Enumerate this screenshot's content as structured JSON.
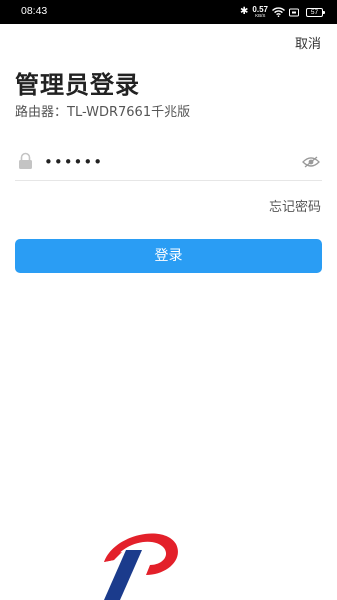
{
  "status_bar": {
    "time": "08:43",
    "network_speed": "0.57",
    "network_unit": "KB/S",
    "battery": "57",
    "icons": [
      "bluetooth-icon",
      "wifi-icon",
      "battery-saver-icon",
      "battery-icon"
    ]
  },
  "header": {
    "cancel_label": "取消",
    "title": "管理员登录",
    "subtitle": "路由器：TL-WDR7661千兆版"
  },
  "form": {
    "password_value": "••••••",
    "password_icon": "lock-icon",
    "toggle_icon": "eye-hidden-icon",
    "forgot_label": "忘记密码",
    "login_label": "登录"
  },
  "colors": {
    "accent": "#2a9df4",
    "logo_red": "#e3202a",
    "logo_blue": "#1b3b8c"
  }
}
